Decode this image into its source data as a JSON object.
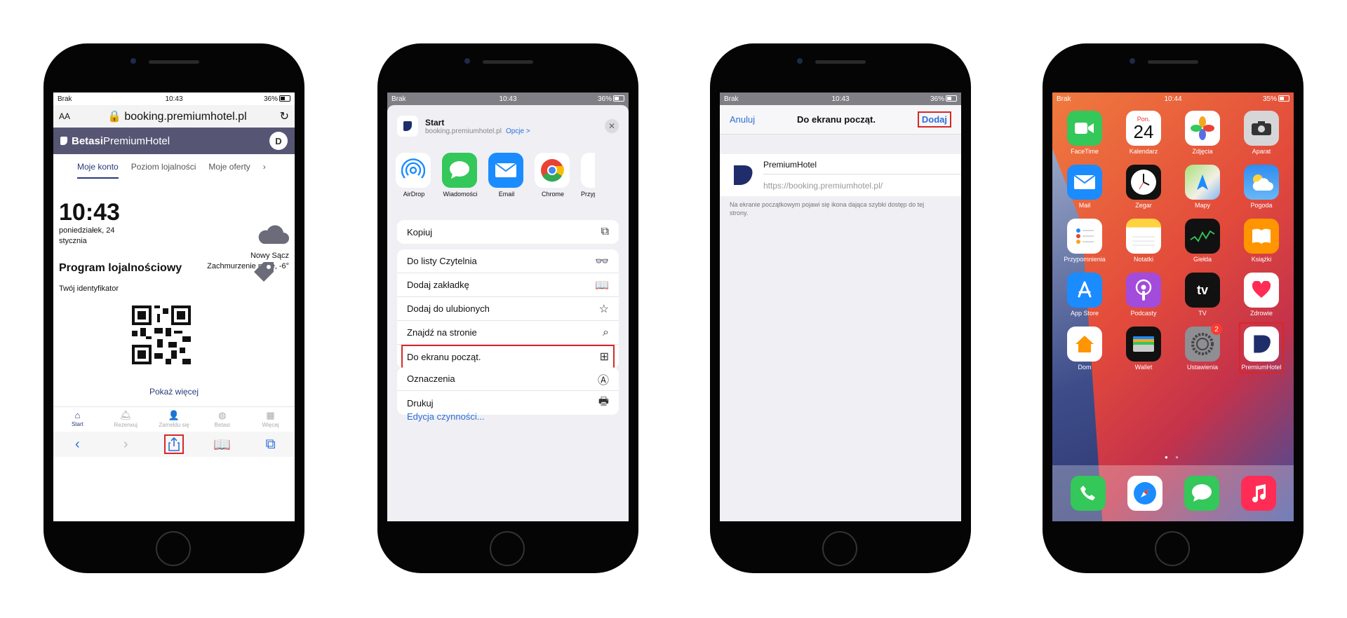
{
  "accent": "#2f6fd6",
  "highlight": "#d62828",
  "phone1": {
    "status": {
      "carrier": "Brak",
      "time": "10:43",
      "battery": "36%"
    },
    "address": {
      "aa": "AA",
      "url": "booking.premiumhotel.pl"
    },
    "header": {
      "brand_bold": "Betasi",
      "brand_rest": " PremiumHotel",
      "avatar": "D"
    },
    "tabs": [
      "Moje konto",
      "Poziom lojalności",
      "Moje oferty"
    ],
    "clock": "10:43",
    "date": "poniedziałek, 24 stycznia",
    "city": "Nowy Sącz",
    "weather": "Zachmurzenie małe, -6°",
    "loyalty_title": "Program lojalnościowy",
    "identifier_label": "Twój identyfikator",
    "show_more": "Pokaż więcej",
    "bottom_nav": [
      "Start",
      "Rezerwuj",
      "Zameldu się",
      "Betasi",
      "Więcej"
    ]
  },
  "phone2": {
    "status": {
      "carrier": "Brak",
      "time": "10:43",
      "battery": "36%"
    },
    "header": {
      "title": "Start",
      "url": "booking.premiumhotel.pl",
      "options": "Opcje >"
    },
    "apps": [
      "AirDrop",
      "Wiadomości",
      "Email",
      "Chrome",
      "Przyp"
    ],
    "group1": [
      "Kopiuj"
    ],
    "group2": [
      "Do listy Czytelnia",
      "Dodaj zakładkę",
      "Dodaj do ulubionych",
      "Znajdź na stronie",
      "Do ekranu począt."
    ],
    "group3": [
      "Oznaczenia",
      "Drukuj"
    ],
    "edit": "Edycja czynności..."
  },
  "phone3": {
    "status": {
      "carrier": "Brak",
      "time": "10:43",
      "battery": "36%"
    },
    "cancel": "Anuluj",
    "title": "Do ekranu począt.",
    "add": "Dodaj",
    "name": "PremiumHotel",
    "url": "https://booking.premiumhotel.pl/",
    "hint": "Na ekranie początkowym pojawi się ikona dająca szybki dostęp do tej strony."
  },
  "phone4": {
    "status": {
      "carrier": "Brak",
      "time": "10:44",
      "battery": "35%"
    },
    "calendar": {
      "day": "Pon.",
      "date": "24"
    },
    "apps": [
      "FaceTime",
      "Kalendarz",
      "Zdjęcia",
      "Aparat",
      "Mail",
      "Zegar",
      "Mapy",
      "Pogoda",
      "Przypomnienia",
      "Notatki",
      "Giełda",
      "Książki",
      "App Store",
      "Podcasty",
      "TV",
      "Zdrowie",
      "Dom",
      "Wallet",
      "Ustawienia",
      "PremiumHotel"
    ],
    "settings_badge": "2",
    "tv_label": "tv"
  }
}
